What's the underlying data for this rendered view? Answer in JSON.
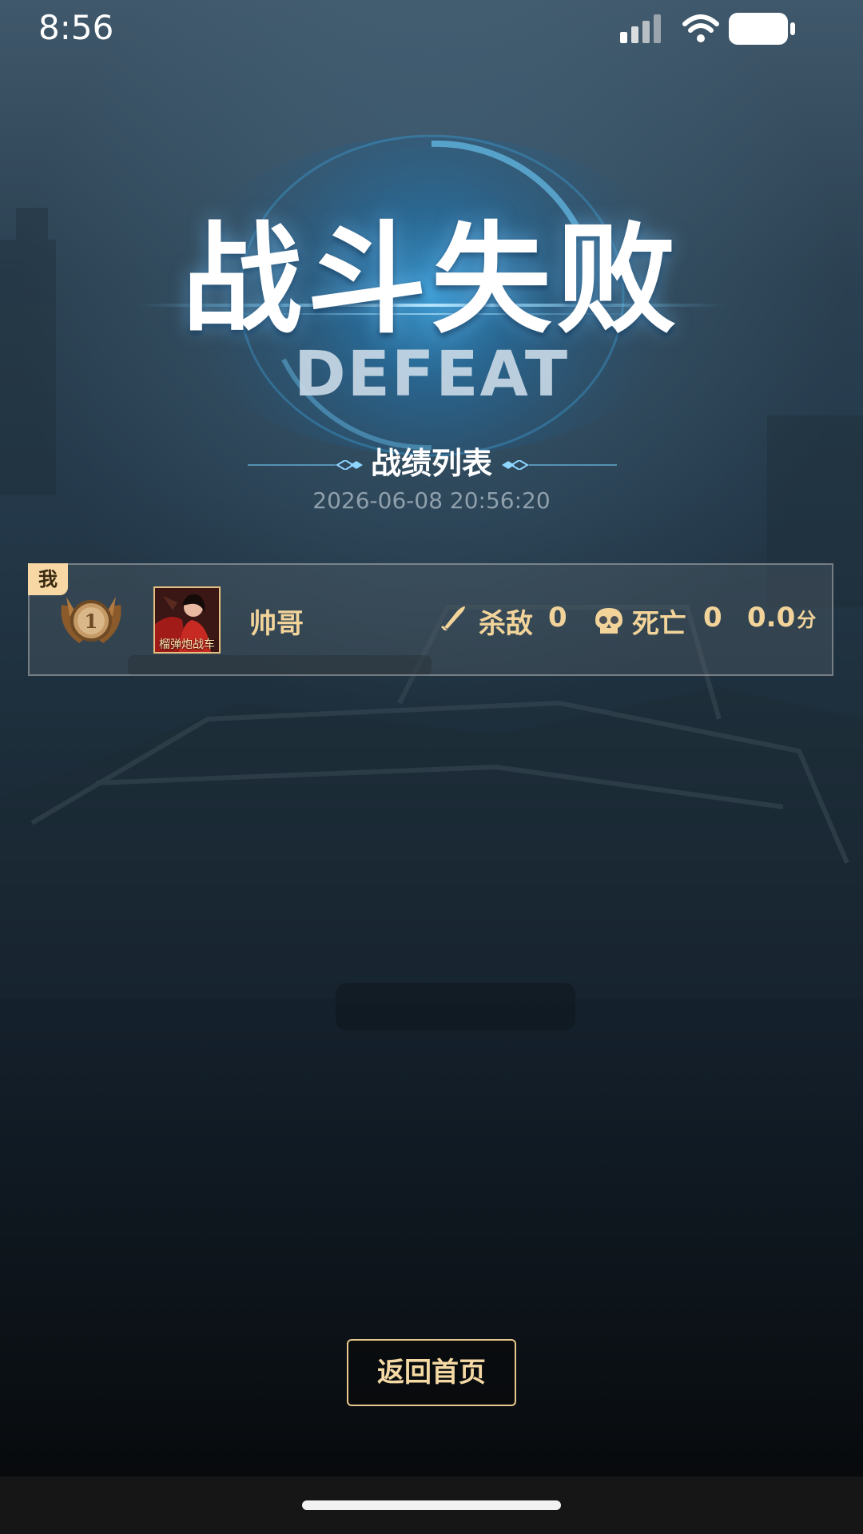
{
  "status_bar": {
    "time": "8:56",
    "icons": [
      "signal-icon",
      "wifi-icon",
      "battery-icon"
    ]
  },
  "result": {
    "title": "战斗失败",
    "subtitle": "DEFEAT",
    "accent_color": "#3fa9e6"
  },
  "section": {
    "title": "战绩列表",
    "timestamp": "2026-06-08 20:56:20"
  },
  "records": [
    {
      "is_me": true,
      "me_label": "我",
      "rank": "1",
      "avatar_caption": "榴弹炮战车",
      "name": "帅哥",
      "kills_label": "杀敌",
      "kills": "0",
      "deaths_label": "死亡",
      "deaths": "0",
      "score": "0.0",
      "score_unit": "分",
      "stat_color": "#f2d49a"
    }
  ],
  "actions": {
    "home_label": "返回首页"
  }
}
